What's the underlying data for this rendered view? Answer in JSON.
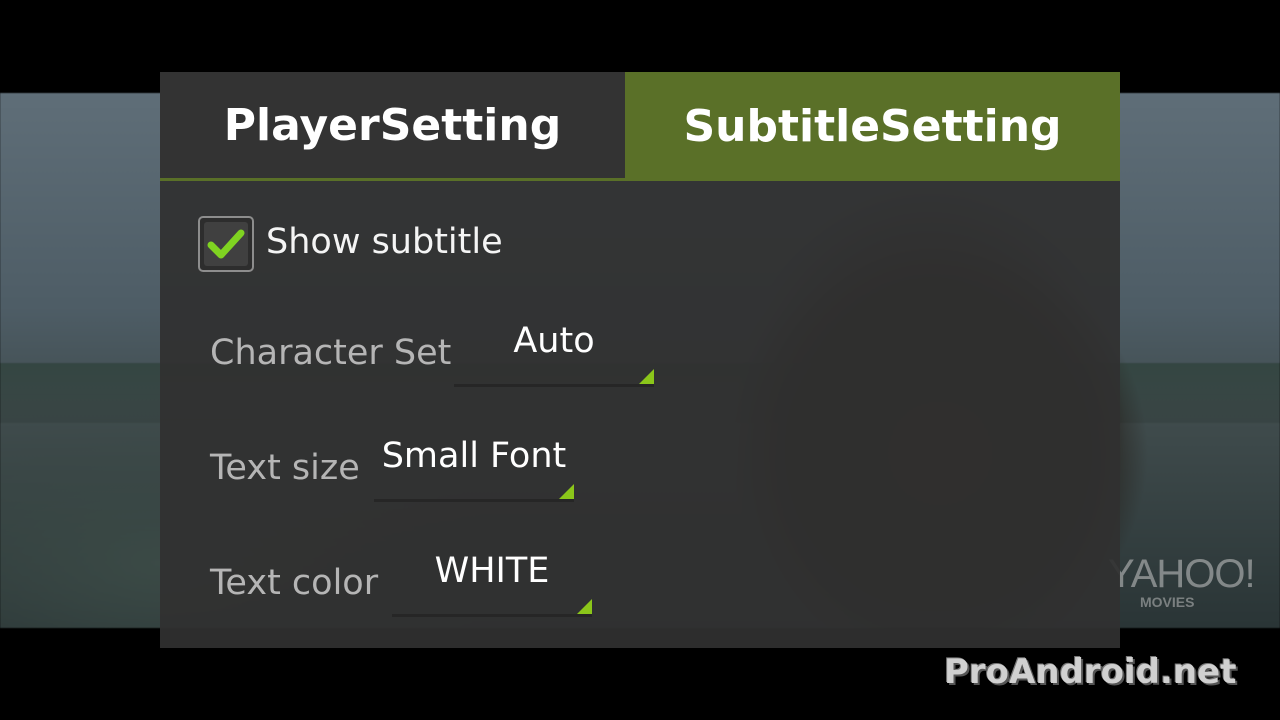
{
  "tabs": [
    {
      "label": "PlayerSetting",
      "selected": false
    },
    {
      "label": "SubtitleSetting",
      "selected": true
    }
  ],
  "show_subtitle": {
    "label": "Show subtitle",
    "checked": true
  },
  "settings": [
    {
      "label": "Character Set",
      "value": "Auto"
    },
    {
      "label": "Text size",
      "value": "Small Font"
    },
    {
      "label": "Text color",
      "value": "WHITE"
    }
  ],
  "watermarks": {
    "yahoo": "YAHOO!",
    "yahoo_sub": "MOVIES",
    "site": "ProAndroid.net"
  },
  "colors": {
    "accent": "#5a7028",
    "spinner_indicator": "#8bc61a",
    "check": "#7fd321"
  }
}
